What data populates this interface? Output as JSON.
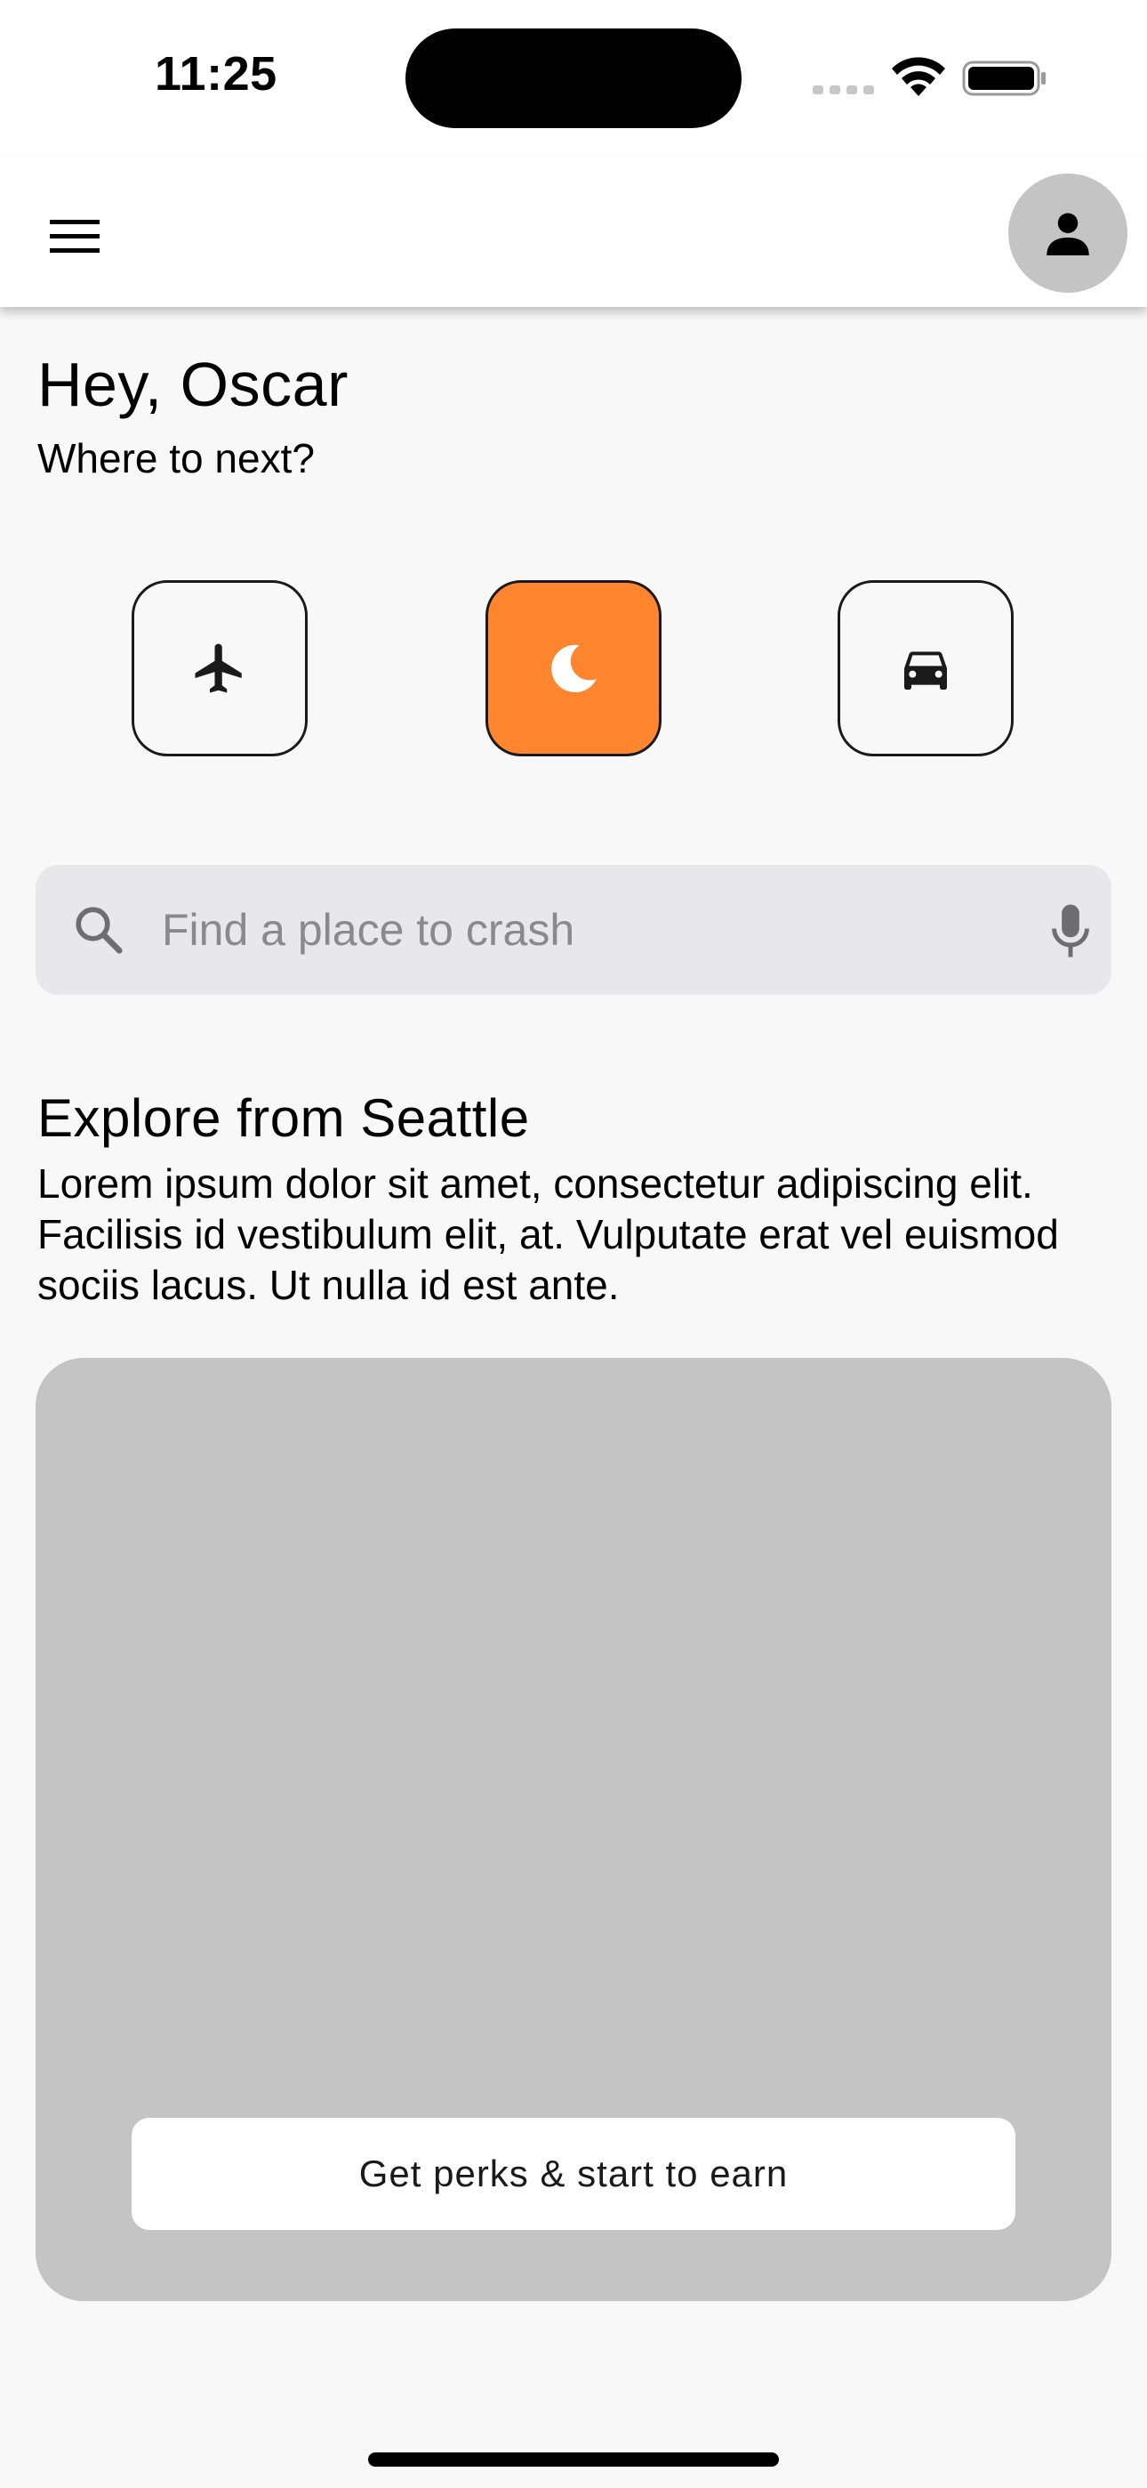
{
  "status_bar": {
    "time": "11:25"
  },
  "header": {
    "menu_icon": "hamburger-menu-icon",
    "avatar_icon": "person-icon"
  },
  "greeting": {
    "title": "Hey, Oscar",
    "subtitle": "Where to next?"
  },
  "modes": [
    {
      "icon": "airplane-icon",
      "selected": false
    },
    {
      "icon": "moon-icon",
      "selected": true
    },
    {
      "icon": "car-icon",
      "selected": false
    }
  ],
  "colors": {
    "accent": "#ff862e",
    "card": "#c4c4c4",
    "search_bg": "#e8e8ea",
    "background": "#f8f8f8"
  },
  "search": {
    "placeholder": "Find a place to crash",
    "value": ""
  },
  "explore": {
    "title": "Explore from Seattle",
    "description": "Lorem ipsum dolor sit amet, consectetur adipiscing elit. Facilisis id vestibulum elit, at. Vulputate erat vel euismod sociis lacus. Ut nulla id est ante.",
    "cta_label": "Get perks & start to earn"
  }
}
